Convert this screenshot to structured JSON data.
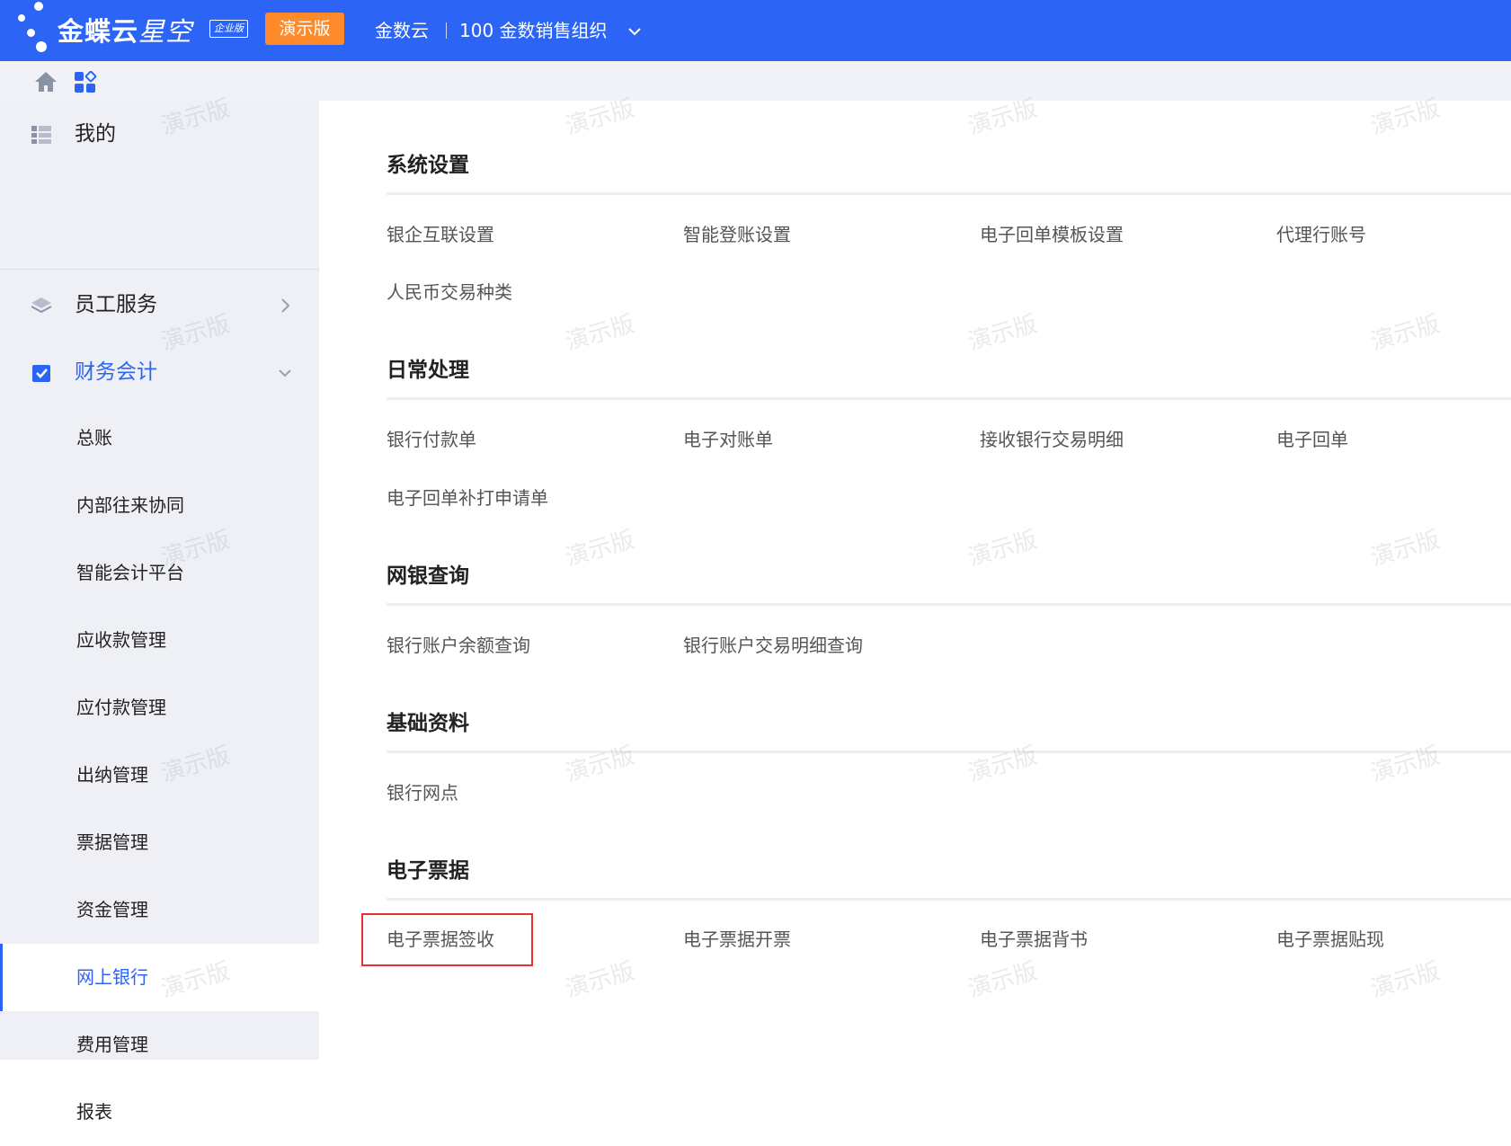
{
  "colors": {
    "primary": "#2c65f6",
    "demo_badge": "#ff8a2b",
    "sidebar_bg": "#eef0f6",
    "highlight_border": "#e83030"
  },
  "header": {
    "brand_name_bold": "金蝶云",
    "brand_name_thin": "星空",
    "edition_badge": "企业版",
    "demo_badge": "演示版",
    "tenant": "金数云",
    "org": "100 金数销售组织"
  },
  "shortcut_bar": {
    "icons": [
      "home-icon",
      "apps-icon"
    ]
  },
  "sidebar": {
    "menus": [
      {
        "label": "我的",
        "icon": "my-icon"
      },
      {
        "label": "员工服务",
        "icon": "layers-icon"
      },
      {
        "label": "财务会计",
        "icon": "checkbox-icon"
      }
    ],
    "sub_items": [
      {
        "label": "总账"
      },
      {
        "label": "内部往来协同"
      },
      {
        "label": "智能会计平台"
      },
      {
        "label": "应收款管理"
      },
      {
        "label": "应付款管理"
      },
      {
        "label": "出纳管理"
      },
      {
        "label": "票据管理"
      },
      {
        "label": "资金管理"
      },
      {
        "label": "网上银行",
        "active": true
      },
      {
        "label": "费用管理"
      },
      {
        "label": "报表"
      }
    ]
  },
  "content": {
    "sections": [
      {
        "title": "系统设置",
        "links": [
          "银企互联设置",
          "智能登账设置",
          "电子回单模板设置",
          "代理行账号",
          "人民币交易种类"
        ]
      },
      {
        "title": "日常处理",
        "links": [
          "银行付款单",
          "电子对账单",
          "接收银行交易明细",
          "电子回单",
          "电子回单补打申请单"
        ]
      },
      {
        "title": "网银查询",
        "links": [
          "银行账户余额查询",
          "银行账户交易明细查询"
        ]
      },
      {
        "title": "基础资料",
        "links": [
          "银行网点"
        ]
      },
      {
        "title": "电子票据",
        "links": [
          "电子票据签收",
          "电子票据开票",
          "电子票据背书",
          "电子票据贴现"
        ]
      }
    ],
    "highlighted_link": "电子票据签收"
  },
  "watermark": "演示版"
}
